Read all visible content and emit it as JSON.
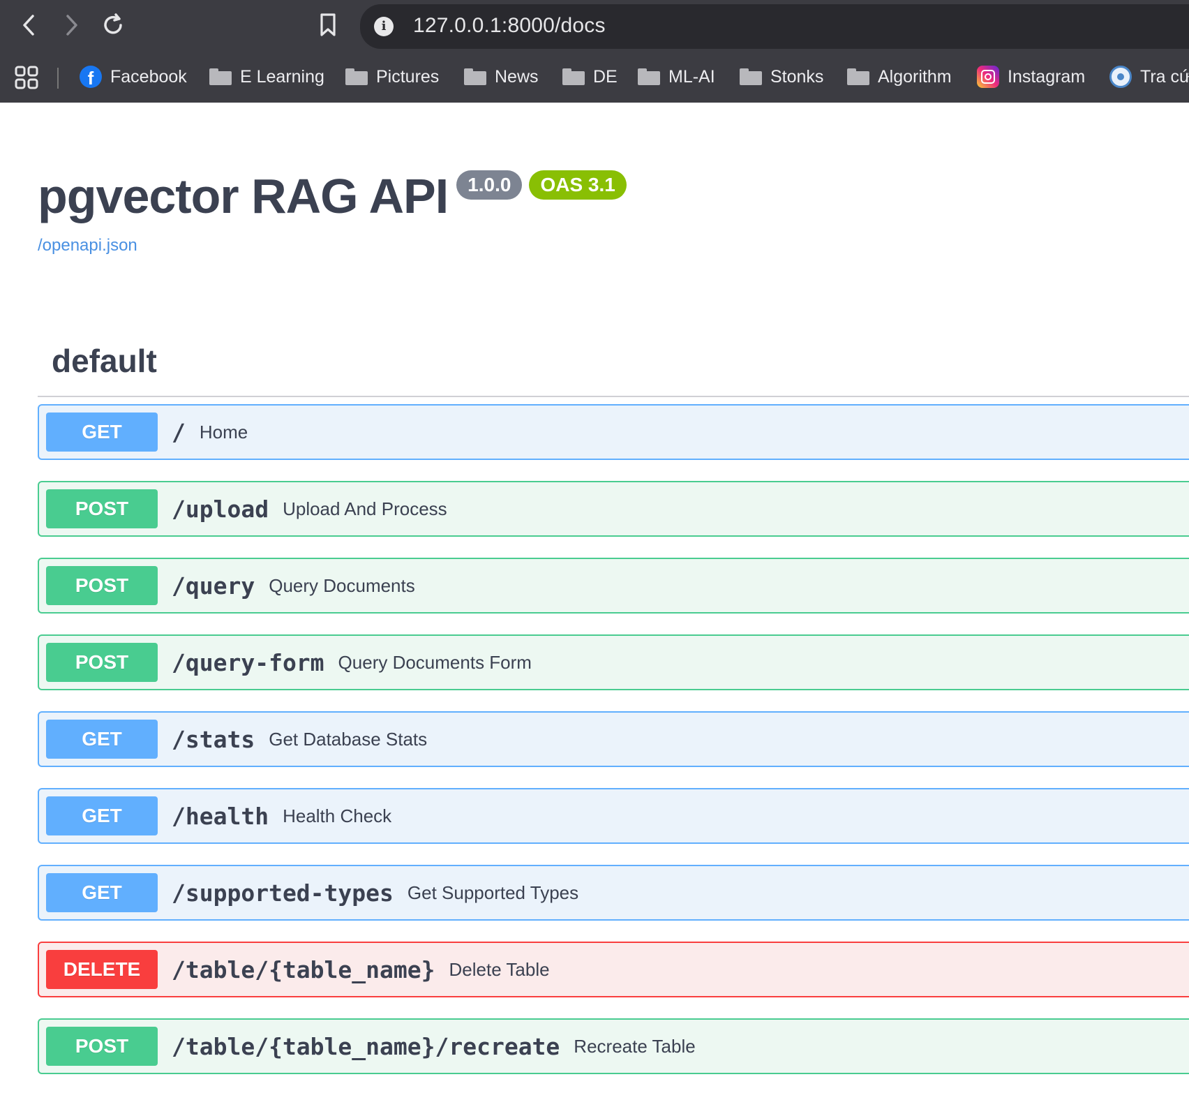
{
  "browser": {
    "url": "127.0.0.1:8000/docs",
    "bookmarks": [
      {
        "label": "Facebook",
        "icon": "facebook-icon"
      },
      {
        "label": "E Learning",
        "icon": "folder-icon"
      },
      {
        "label": "Pictures",
        "icon": "folder-icon"
      },
      {
        "label": "News",
        "icon": "folder-icon"
      },
      {
        "label": "DE",
        "icon": "folder-icon"
      },
      {
        "label": "ML-AI",
        "icon": "folder-icon"
      },
      {
        "label": "Stonks",
        "icon": "folder-icon"
      },
      {
        "label": "Algorithm",
        "icon": "folder-icon"
      },
      {
        "label": "Instagram",
        "icon": "instagram-icon"
      },
      {
        "label": "Tra cứ",
        "icon": "government-icon"
      }
    ]
  },
  "info": {
    "title": "pgvector RAG API",
    "version": "1.0.0",
    "oas": "OAS 3.1",
    "spec_link": "/openapi.json"
  },
  "tag": {
    "name": "default"
  },
  "colors": {
    "get": "#61affe",
    "post": "#49cc90",
    "delete": "#f93e3e",
    "version_badge": "#7d8492",
    "oas_badge": "#89bf04",
    "link": "#4990e2"
  },
  "operations": [
    {
      "method": "GET",
      "path": "/",
      "summary": "Home"
    },
    {
      "method": "POST",
      "path": "/upload",
      "summary": "Upload And Process"
    },
    {
      "method": "POST",
      "path": "/query",
      "summary": "Query Documents"
    },
    {
      "method": "POST",
      "path": "/query-form",
      "summary": "Query Documents Form"
    },
    {
      "method": "GET",
      "path": "/stats",
      "summary": "Get Database Stats"
    },
    {
      "method": "GET",
      "path": "/health",
      "summary": "Health Check"
    },
    {
      "method": "GET",
      "path": "/supported-types",
      "summary": "Get Supported Types"
    },
    {
      "method": "DELETE",
      "path": "/table/{table_name}",
      "summary": "Delete Table"
    },
    {
      "method": "POST",
      "path": "/table/{table_name}/recreate",
      "summary": "Recreate Table"
    }
  ]
}
